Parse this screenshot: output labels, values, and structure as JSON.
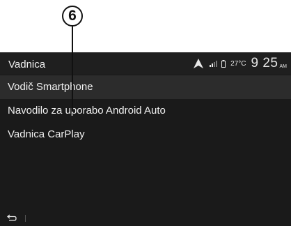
{
  "callout": {
    "number": "6"
  },
  "header": {
    "title": "Vadnica",
    "temperature": "27°C",
    "time": "9 25",
    "ampm": "AM"
  },
  "menu": {
    "items": [
      {
        "label": "Vodič Smartphone",
        "selected": true
      },
      {
        "label": "Navodilo za uporabo Android Auto",
        "selected": false
      },
      {
        "label": "Vadnica CarPlay",
        "selected": false
      }
    ]
  },
  "icons": {
    "android_auto": "android-auto-icon",
    "signal": "signal-icon",
    "battery": "battery-icon",
    "back": "back-icon"
  }
}
